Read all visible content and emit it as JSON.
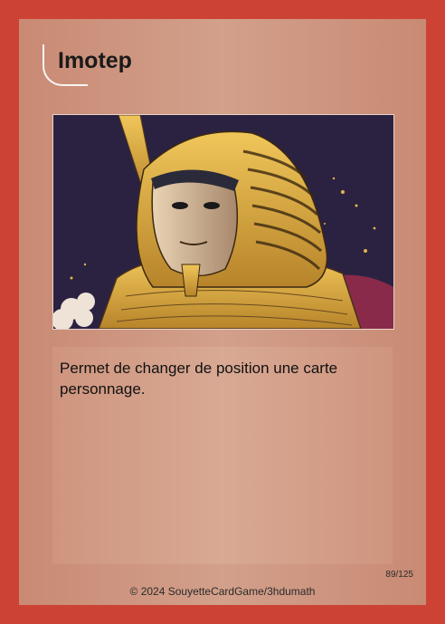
{
  "card": {
    "title": "Imotep",
    "effect_text": "Permet de changer de position une carte personnage.",
    "counter": "89/125",
    "copyright": "© 2024 SouyetteCardGame/3hdumath",
    "colors": {
      "frame": "#cc4335",
      "panel": "#d2a08b",
      "art_background": "#2b2242",
      "gold": "#d9a83a"
    }
  }
}
